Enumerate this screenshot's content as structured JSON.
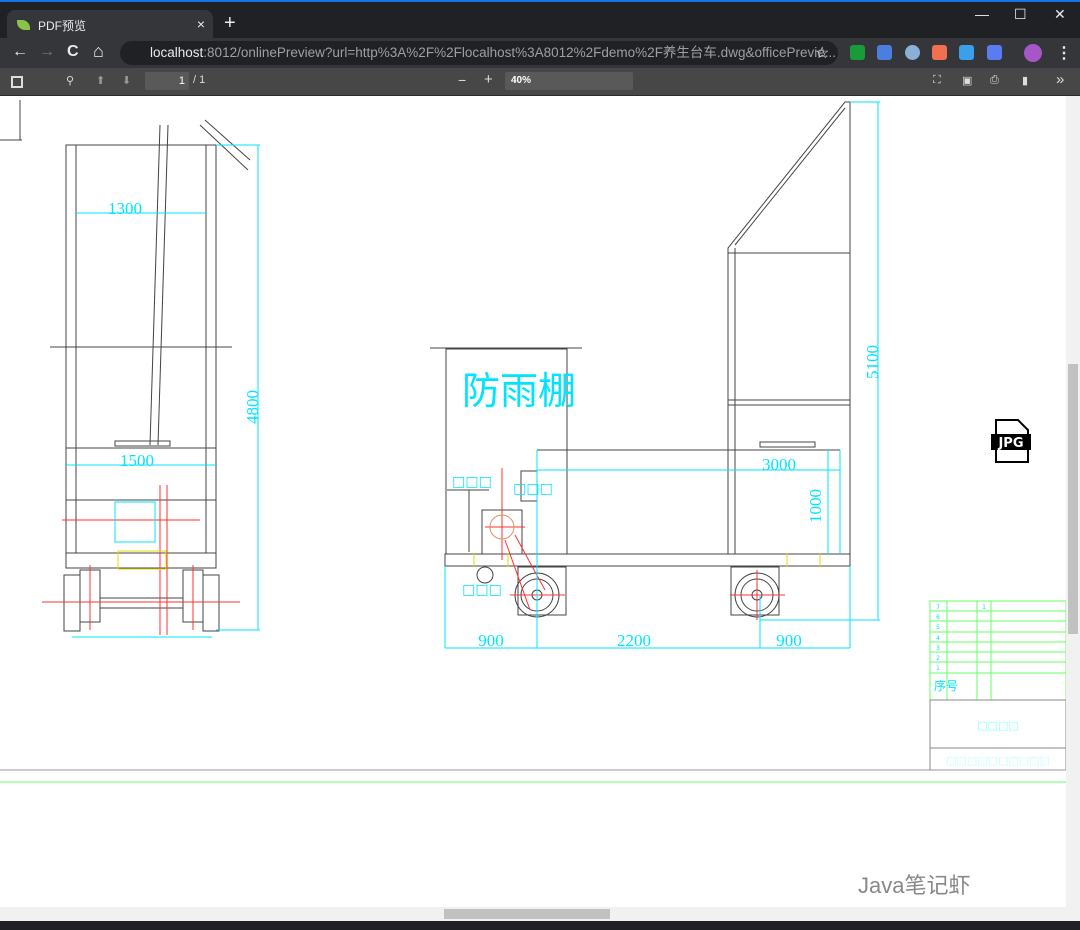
{
  "browser": {
    "tab_title": "PDF预览",
    "tab_close": "×",
    "new_tab": "+",
    "minimize": "—",
    "maximize": "☐",
    "close": "✕",
    "url_host": "localhost",
    "url_rest": ":8012/onlinePreview?url=http%3A%2F%2Flocalhost%3A8012%2Fdemo%2F养生台车.dwg&officePrevie...",
    "back": "←",
    "forward": "→",
    "reload": "C",
    "home": "⌂",
    "star": "☆",
    "menu": "⋮"
  },
  "pdf_toolbar": {
    "page_current": "1",
    "page_total": "/ 1",
    "zoom": "40%",
    "zoom_out": "−",
    "zoom_in": "+",
    "more": "»"
  },
  "drawing": {
    "left_view": {
      "dim_top": "1300",
      "dim_mid": "1500",
      "dim_height": "4800"
    },
    "right_view": {
      "label_canopy": "防雨棚",
      "dim_height": "5100",
      "dim_3000": "3000",
      "dim_1000": "1000",
      "dim_900_left": "900",
      "dim_2200": "2200",
      "dim_900_right": "900",
      "label_a": "□□□",
      "label_b": "□□□",
      "label_c": "□□□"
    },
    "title_block": {
      "rows": [
        "7",
        "6",
        "5",
        "4",
        "3",
        "2",
        "1"
      ],
      "qty": "1",
      "header_no": "序号",
      "name_text": "□□□□",
      "bottom_text": "□□□□□□□□□□"
    },
    "file_icon": "JPG"
  },
  "colors": {
    "dimension": "#00ffff",
    "titleblock": "#66ff66",
    "line": "#333333",
    "center": "#ff2020"
  },
  "watermark": "Java笔记虾"
}
